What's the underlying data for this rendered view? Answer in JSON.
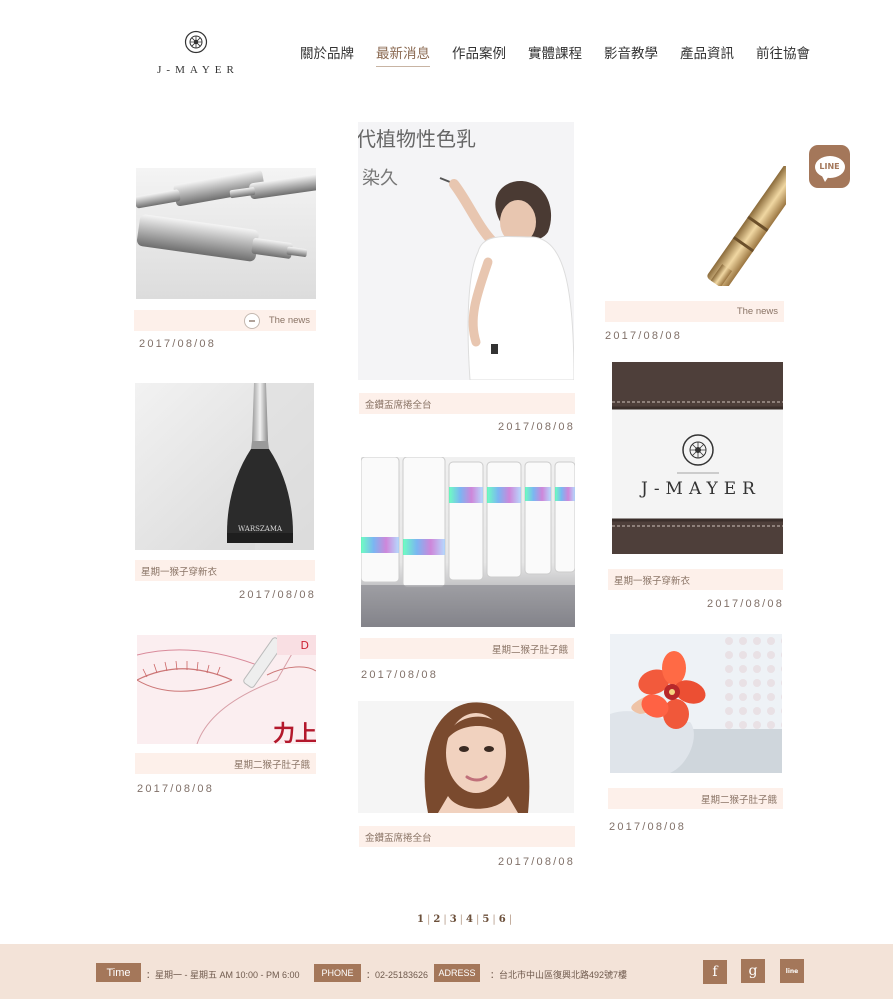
{
  "brand": {
    "logo_text": "J-MAYER"
  },
  "nav": {
    "items": [
      {
        "label": "關於品牌"
      },
      {
        "label": "最新消息"
      },
      {
        "label": "作品案例"
      },
      {
        "label": "實體課程"
      },
      {
        "label": "影音教學"
      },
      {
        "label": "產品資訊"
      },
      {
        "label": "前往協會"
      }
    ],
    "active": "最新消息"
  },
  "line_button": {
    "label": "LINE"
  },
  "posts": [
    {
      "caption": "The news",
      "date": "2017/08/08"
    },
    {
      "caption": "星期一猴子穿新衣",
      "date": "2017/08/08"
    },
    {
      "caption": "星期二猴子肚子餓",
      "date": "2017/08/08"
    },
    {
      "caption": "金鑽盃席捲全台",
      "date": "2017/08/08"
    },
    {
      "caption": "星期二猴子肚子餓",
      "date": "2017/08/08"
    },
    {
      "caption": "金鑽盃席捲全台",
      "date": "2017/08/08"
    },
    {
      "caption": "The news",
      "date": "2017/08/08"
    },
    {
      "caption": "星期一猴子穿新衣",
      "date": "2017/08/08"
    },
    {
      "caption": "星期二猴子肚子餓",
      "date": "2017/08/08"
    }
  ],
  "image_texts": {
    "whiteboard_line1": "代植物性色乳",
    "whiteboard_line2": "染久",
    "wand_brand": "WARSZAMA",
    "lash_text": "力上",
    "jmayer_board": "J-MAYER"
  },
  "pagination": [
    "1",
    "2",
    "3",
    "4",
    "5",
    "6"
  ],
  "footer": {
    "time_label": "Time",
    "time_value": "：星期一 - 星期五 AM 10:00 - PM 6:00",
    "phone_label": "PHONE",
    "phone_value": "：02-25183626",
    "address_label": "ADRESS",
    "address_value": "：台北市中山區復興北路492號7樓",
    "social": [
      "f",
      "g",
      "line"
    ]
  },
  "colors": {
    "accent": "#a4775a",
    "caption_bg": "#fdf0ea",
    "footer_bg": "#f3e3d8"
  }
}
